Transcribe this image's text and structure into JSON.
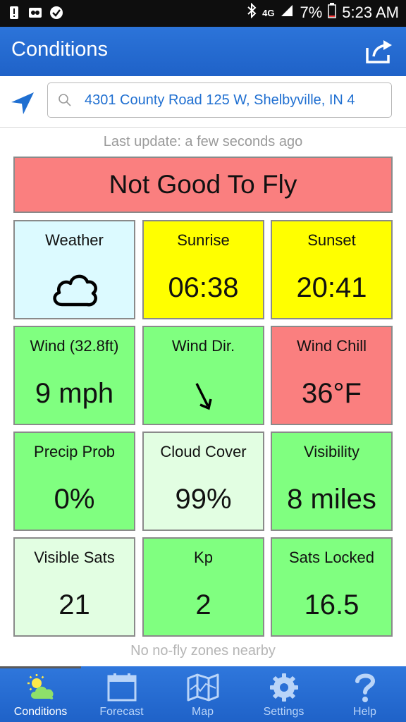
{
  "status_bar": {
    "network": "4G",
    "battery": "7%",
    "time": "5:23 AM"
  },
  "app_bar": {
    "title": "Conditions"
  },
  "search": {
    "value": "4301 County Road 125 W, Shelbyville, IN 4"
  },
  "last_update": "Last update: a few seconds ago",
  "verdict": "Not Good To Fly",
  "tiles": [
    {
      "label": "Weather",
      "value": "",
      "icon": "cloud-icon",
      "color": "#dcfaff"
    },
    {
      "label": "Sunrise",
      "value": "06:38",
      "color": "#ffff00"
    },
    {
      "label": "Sunset",
      "value": "20:41",
      "color": "#ffff00"
    },
    {
      "label": "Wind (32.8ft)",
      "value": "9 mph",
      "color": "#80ff80"
    },
    {
      "label": "Wind Dir.",
      "value": "",
      "icon": "arrow-down-right-icon",
      "color": "#80ff80"
    },
    {
      "label": "Wind Chill",
      "value": "36°F",
      "color": "#fa7f7f"
    },
    {
      "label": "Precip Prob",
      "value": "0%",
      "color": "#80ff80"
    },
    {
      "label": "Cloud Cover",
      "value": "99%",
      "color": "#e2fee2"
    },
    {
      "label": "Visibility",
      "value": "8 miles",
      "color": "#80ff80"
    },
    {
      "label": "Visible Sats",
      "value": "21",
      "color": "#e2fee2"
    },
    {
      "label": "Kp",
      "value": "2",
      "color": "#80ff80"
    },
    {
      "label": "Sats Locked",
      "value": "16.5",
      "color": "#80ff80"
    }
  ],
  "no_fly_zones": "No no-fly zones nearby",
  "nav": [
    {
      "label": "Conditions",
      "icon": "sun-cloud-icon",
      "active": true
    },
    {
      "label": "Forecast",
      "icon": "calendar-icon",
      "active": false
    },
    {
      "label": "Map",
      "icon": "map-icon",
      "active": false
    },
    {
      "label": "Settings",
      "icon": "gear-icon",
      "active": false
    },
    {
      "label": "Help",
      "icon": "question-icon",
      "active": false
    }
  ],
  "colors": {
    "app_bar": "#1f62c8",
    "not_good": "#fa7f7f",
    "good": "#80ff80",
    "caution": "#ffff00"
  }
}
